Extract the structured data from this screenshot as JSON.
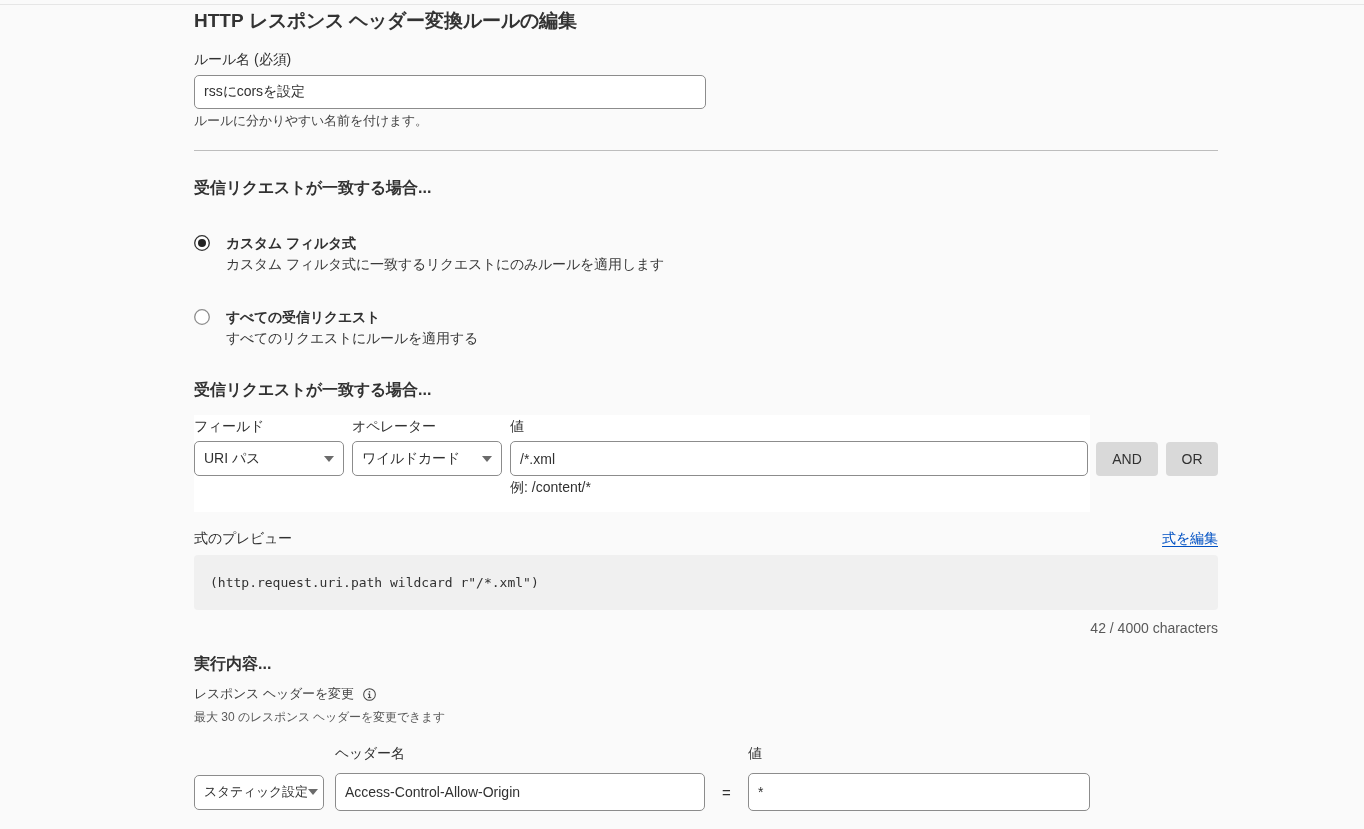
{
  "page": {
    "title": "HTTP レスポンス ヘッダー変換ルールの編集"
  },
  "rule_name": {
    "label": "ルール名 (必須)",
    "value": "rssにcorsを設定",
    "hint": "ルールに分かりやすい名前を付けます。"
  },
  "match": {
    "heading": "受信リクエストが一致する場合...",
    "options": [
      {
        "label": "カスタム フィルタ式",
        "description": "カスタム フィルタ式に一致するリクエストにのみルールを適用します",
        "selected": true
      },
      {
        "label": "すべての受信リクエスト",
        "description": "すべてのリクエストにルールを適用する",
        "selected": false
      }
    ]
  },
  "filter": {
    "heading": "受信リクエストが一致する場合...",
    "columns": [
      "フィールド",
      "オペレーター",
      "値"
    ],
    "field": "URI パス",
    "operator": "ワイルドカード",
    "value": "/*.xml",
    "example": "例: /content/*",
    "buttons": [
      "AND",
      "OR"
    ]
  },
  "preview": {
    "label": "式のプレビュー",
    "edit_link": "式を編集",
    "expression": "(http.request.uri.path wildcard r\"/*.xml\")",
    "count": "42 / 4000 characters"
  },
  "action": {
    "heading": "実行内容...",
    "label": "レスポンス ヘッダーを変更",
    "note": "最大 30 のレスポンス ヘッダーを変更できます",
    "header_label": "ヘッダー名",
    "value_label": "値",
    "mode": "スタティック設定",
    "name": "Access-Control-Allow-Origin",
    "operator": "=",
    "value": "*"
  }
}
